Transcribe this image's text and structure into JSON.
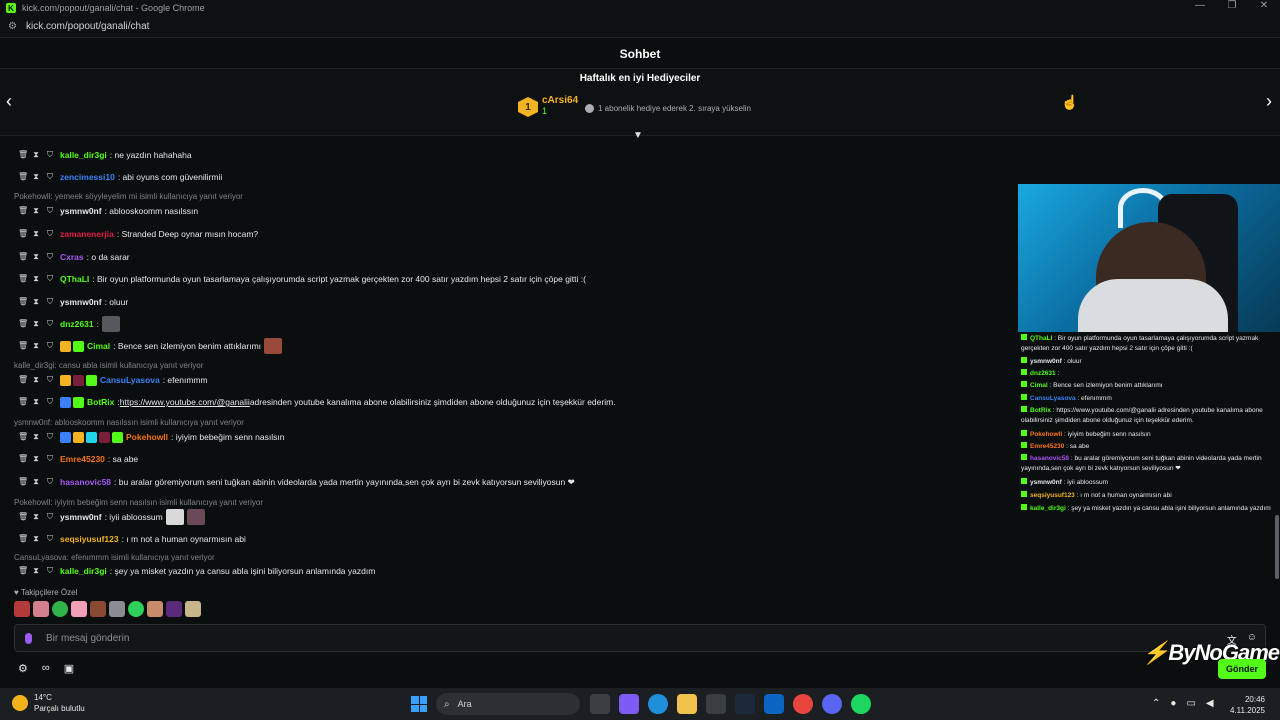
{
  "browser": {
    "window_title": "kick.com/popout/ganali/chat - Google Chrome",
    "url": "kick.com/popout/ganali/chat",
    "winctl": [
      "—",
      "❐",
      "✕"
    ]
  },
  "chat": {
    "title": "Sohbet",
    "gifters": {
      "title": "Haftalık en iyi Hediyeciler",
      "rank": "1",
      "top_name": "cArsi64",
      "top_count": "1",
      "promo": "1 abonelik hediye ederek 2. sıraya yükselin"
    },
    "messages": [
      {
        "user": "kalle_dir3gi",
        "color": "#53fc18",
        "text": ": ne yazdın hahahaha"
      },
      {
        "user": "zencimessi10",
        "color": "#3b82f6",
        "text": ": abi oyuns com güvenilirmii"
      },
      {
        "reply": "Pokehowll: yemeek söyyleyelim mi isimli kullanıcıya yanıt veriyor"
      },
      {
        "user": "ysmnw0nf",
        "color": "#e6e8ea",
        "text": ": ablooskoomm nasılssın"
      },
      {
        "user": "zamanenerjia",
        "color": "#e11d48",
        "text": ": Stranded Deep oynar mısın hocam?"
      },
      {
        "user": "Cxras",
        "color": "#a855f7",
        "text": ": o da sarar"
      },
      {
        "user": "QThaLI",
        "color": "#53fc18",
        "text": ": Bir oyun platformunda oyun tasarlamaya çalışıyorumda script yazmak gerçekten zor 400 satır yazdım hepsi 2 satır için çöpe gitti :("
      },
      {
        "user": "ysmnw0nf",
        "color": "#e6e8ea",
        "text": ": oluur"
      },
      {
        "user": "dnz2631",
        "color": "#53fc18",
        "text": ":"
      },
      {
        "user": "Cimal",
        "color": "#53fc18",
        "text": ": Bence sen izlemiyon benim attıklarımı"
      },
      {
        "reply": "kalle_dir3gi: cansu abla isimli kullanıcıya yanıt veriyor"
      },
      {
        "user": "CansuLyasova",
        "color": "#3b82f6",
        "text": ": efenımmm"
      },
      {
        "user": "BotRix",
        "color": "#53fc18",
        "text": ": ",
        "link": "https://www.youtube.com/@ganalii",
        "text2": " adresinden youtube kanalıma abone olabilirsiniz şimdiden abone olduğunuz için teşekkür ederim."
      },
      {
        "reply": "ysmnw0nf: ablooskoomm nasılssın isimli kullanıcıya yanıt veriyor"
      },
      {
        "user": "Pokehowll",
        "color": "#f97316",
        "text": ": iyiyim bebeğim senn nasılsın"
      },
      {
        "user": "Emre45230",
        "color": "#f97316",
        "text": ": sa abe"
      },
      {
        "user": "hasanovic58",
        "color": "#a855f7",
        "text": ": bu aralar göremiyorum seni tuğkan abinin videolarda yada mertin yayınında,sen çok ayrı bi zevk katıyorsun seviliyosun ❤"
      },
      {
        "reply": "Pokehowll: iyiyim bebeğim senn nasılsın isimli kullanıcıya yanıt veriyor"
      },
      {
        "user": "ysmnw0nf",
        "color": "#e6e8ea",
        "text": ": iyii abloossum"
      },
      {
        "user": "seqsiyusuf123",
        "color": "#f4b322",
        "text": ": ı m not a human oynarmısın abi"
      },
      {
        "reply": "CansuLyasova: efenımmm isimli kullanıcıya yanıt veriyor"
      },
      {
        "user": "kalle_dir3gi",
        "color": "#53fc18",
        "text": ": şey ya misket yazdın ya cansu abla işini biliyorsun anlamında yazdım"
      }
    ],
    "follower_label": "♥ Takipçilere Özel",
    "input_placeholder": "Bir mesaj gönderin",
    "send_label": "Gönder"
  },
  "overlay": {
    "watermark": "ByNoGame",
    "lines": [
      {
        "user": "QThaLI",
        "color": "#53fc18",
        "text": " : Bir oyun platformunda oyun tasarlamaya çalışıyorumda script yazmak gerçekten zor 400 satır yazdım hepsi 2 satır için çöpe gitti :("
      },
      {
        "user": "ysmnw0nf",
        "color": "#e6e8ea",
        "text": " : oluur"
      },
      {
        "user": "dnz2631",
        "color": "#53fc18",
        "text": " :"
      },
      {
        "user": "Cimal",
        "color": "#53fc18",
        "text": " : Bence sen izlemiyon benim attıklarımı"
      },
      {
        "user": "CansuLyasova",
        "color": "#3b82f6",
        "text": " : efenımmm"
      },
      {
        "user": "BotRix",
        "color": "#53fc18",
        "text": " : https://www.youtube.com/@ganalii adresinden youtube kanalıma abone olabilirsiniz şimdiden abone olduğunuz için teşekkür ederim."
      },
      {
        "user": "Pokehowll",
        "color": "#f97316",
        "text": " : iyiyim bebeğim senn nasılsın"
      },
      {
        "user": "Emre45230",
        "color": "#f97316",
        "text": " : sa abe"
      },
      {
        "user": "hasanovic58",
        "color": "#a855f7",
        "text": " : bu aralar göremiyorum seni tuğkan abinin videolarda yada mertin yayınında,sen çok ayrı bi zevk katıyorsun seviliyosun ❤"
      },
      {
        "user": "ysmnw0nf",
        "color": "#e6e8ea",
        "text": " : iyii abloossum"
      },
      {
        "user": "seqsiyusuf123",
        "color": "#f4b322",
        "text": " : ı m not a human oynarmısın abi"
      },
      {
        "user": "kalle_dir3gi",
        "color": "#53fc18",
        "text": " : şey ya misket yazdın ya cansu abla işini biliyorsun anlamında yazdım"
      }
    ]
  },
  "taskbar": {
    "temp": "14°C",
    "weather": "Parçalı bulutlu",
    "search": "Ara",
    "time": "20:46",
    "date": "4.11.2025"
  }
}
